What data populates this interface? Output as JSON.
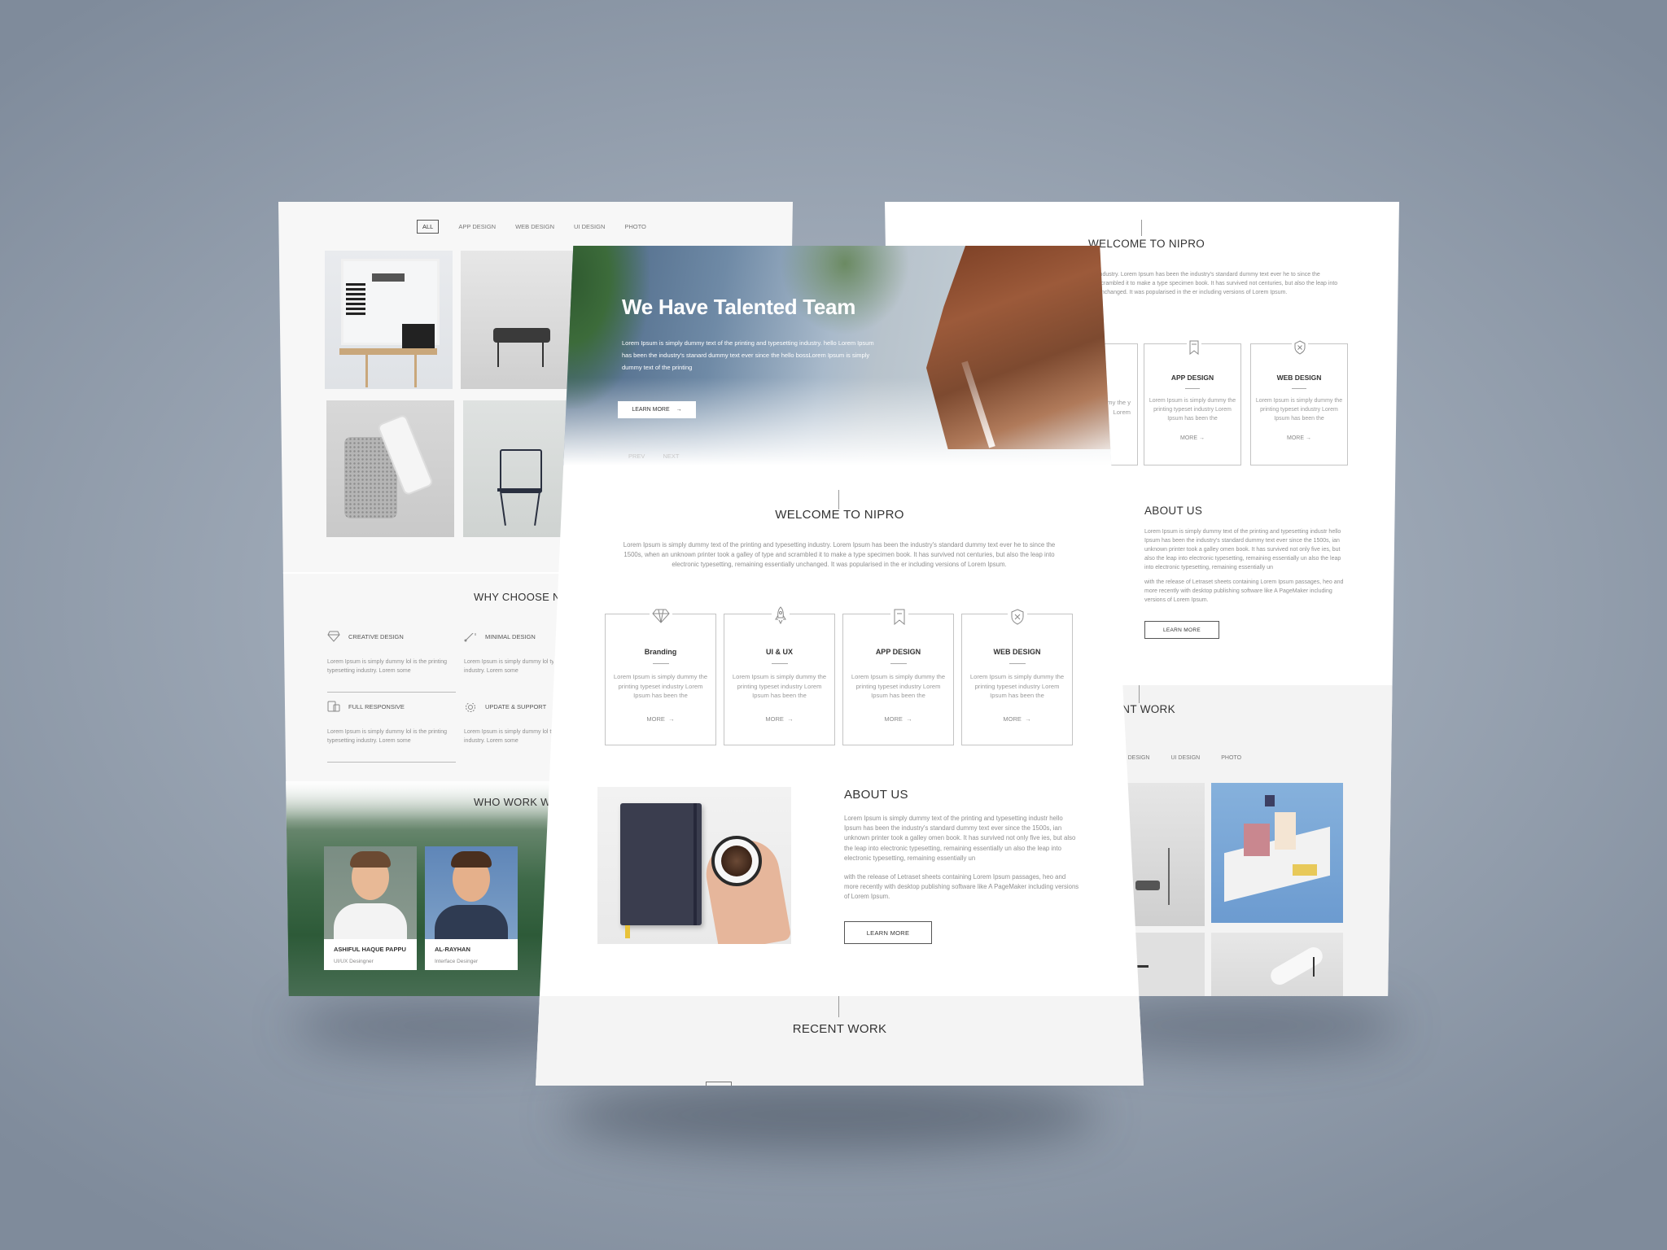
{
  "left_page": {
    "filters": [
      "ALL",
      "APP DESIGN",
      "WEB DESIGN",
      "UI DESIGN",
      "PHOTO"
    ],
    "why_title": "WHY CHOOSE NI",
    "features": [
      {
        "title": "CREATIVE DESIGN",
        "icon": "diamond-icon",
        "text": "Lorem Ipsum is simply dummy lol is the printing typesetting industry. Lorem some"
      },
      {
        "title": "MINIMAL DESIGN",
        "icon": "pen-tool-icon",
        "text": "Lorem Ipsum is simply dummy lol typesetting industry. Lorem some"
      },
      {
        "title": "FULL RESPONSIVE",
        "icon": "responsive-icon",
        "text": "Lorem Ipsum is simply dummy lol is the printing typesetting industry. Lorem some"
      },
      {
        "title": "UPDATE & SUPPORT",
        "icon": "gear-icon",
        "text": "Lorem Ipsum is simply dummy lol typesetting industry. Lorem some"
      }
    ],
    "team_title": "WHO WORK W",
    "team": [
      {
        "name": "ASHIFUL HAQUE PAPPU",
        "role": "UI/UX Desingner"
      },
      {
        "name": "AL-RAYHAN",
        "role": "Interface Desinger"
      }
    ]
  },
  "right_page": {
    "welcome_title": "WELCOME TO NIPRO",
    "welcome_text": "industry. Lorem Ipsum has been the industry's standard dummy text ever he to since the scrambled it to make a type specimen book. It has survived not centuries, but also the leap into unchanged. It was popularised in the er including versions of Lorem Ipsum.",
    "partial_card_text": "ummy the y Lorem",
    "services": [
      {
        "title": "APP DESIGN",
        "icon": "bookmark-icon",
        "text": "Lorem Ipsum is simply dummy the printing typeset industry Lorem Ipsum has been the",
        "more": "MORE"
      },
      {
        "title": "WEB DESIGN",
        "icon": "shield-icon",
        "text": "Lorem Ipsum is simply dummy the printing typeset industry Lorem Ipsum has been the",
        "more": "MORE"
      }
    ],
    "about_title": "ABOUT US",
    "about_p1": "Lorem Ipsum is simply dummy text of the printing and typesetting industr hello Ipsum has been the industry's standard dummy text ever since the 1500s, ian unknown printer took a galley omen book. It has survived not only five ies, but also the leap into electronic typesetting, remaining essentially un also the leap into electronic typesetting, remaining essentially un",
    "about_p2": "with the release of Letraset sheets containing Lorem Ipsum passages, heo and more recently with desktop publishing software like A PageMaker including versions of Lorem Ipsum.",
    "about_button": "LEARN MORE",
    "recent_title": "ENT WORK",
    "filters": [
      "B DESIGN",
      "UI DESIGN",
      "PHOTO"
    ]
  },
  "center_page": {
    "hero": {
      "title": "We Have Talented Team",
      "text": "Lorem Ipsum is simply dummy text of the printing and typesetting industry. hello Lorem Ipsum has been the industry's stanard dummy text ever since the hello bossLorem Ipsum is simply dummy text of the printing",
      "button": "LEARN MORE",
      "prev": "PREV",
      "next": "NEXT"
    },
    "welcome": {
      "title": "WELCOME TO NIPRO",
      "text": "Lorem Ipsum is simply dummy text of the printing and typesetting industry. Lorem Ipsum has been the industry's standard dummy text ever he to since the 1500s, when an unknown printer took a galley of type and scrambled it to make a type specimen book. It has survived not centuries, but also the leap into electronic typesetting, remaining essentially unchanged. It was popularised in the er including versions of Lorem Ipsum."
    },
    "services": [
      {
        "title": "Branding",
        "icon": "diamond-icon",
        "text": "Lorem Ipsum is simply dummy the printing typeset industry Lorem Ipsum has been the",
        "more": "MORE"
      },
      {
        "title": "UI & UX",
        "icon": "rocket-icon",
        "text": "Lorem Ipsum is simply dummy the printing typeset industry Lorem Ipsum has been the",
        "more": "MORE"
      },
      {
        "title": "APP DESIGN",
        "icon": "bookmark-icon",
        "text": "Lorem Ipsum is simply dummy the printing typeset industry Lorem Ipsum has been the",
        "more": "MORE"
      },
      {
        "title": "WEB DESIGN",
        "icon": "shield-icon",
        "text": "Lorem Ipsum is simply dummy the printing typeset industry Lorem Ipsum has been the",
        "more": "MORE"
      }
    ],
    "about": {
      "title": "ABOUT US",
      "p1": "Lorem Ipsum is simply dummy text of the printing and typesetting industr hello Ipsum has been the industry's standard dummy text ever since the 1500s, ian unknown printer took a galley omen book. It has survived not only five ies, but also the leap into electronic typesetting, remaining essentially un also the leap into electronic typesetting, remaining essentially un",
      "p2": "with the release of Letraset sheets containing Lorem Ipsum passages, heo and more recently with desktop publishing software like A PageMaker including versions of Lorem Ipsum.",
      "button": "LEARN MORE"
    },
    "recent_title": "RECENT WORK"
  }
}
